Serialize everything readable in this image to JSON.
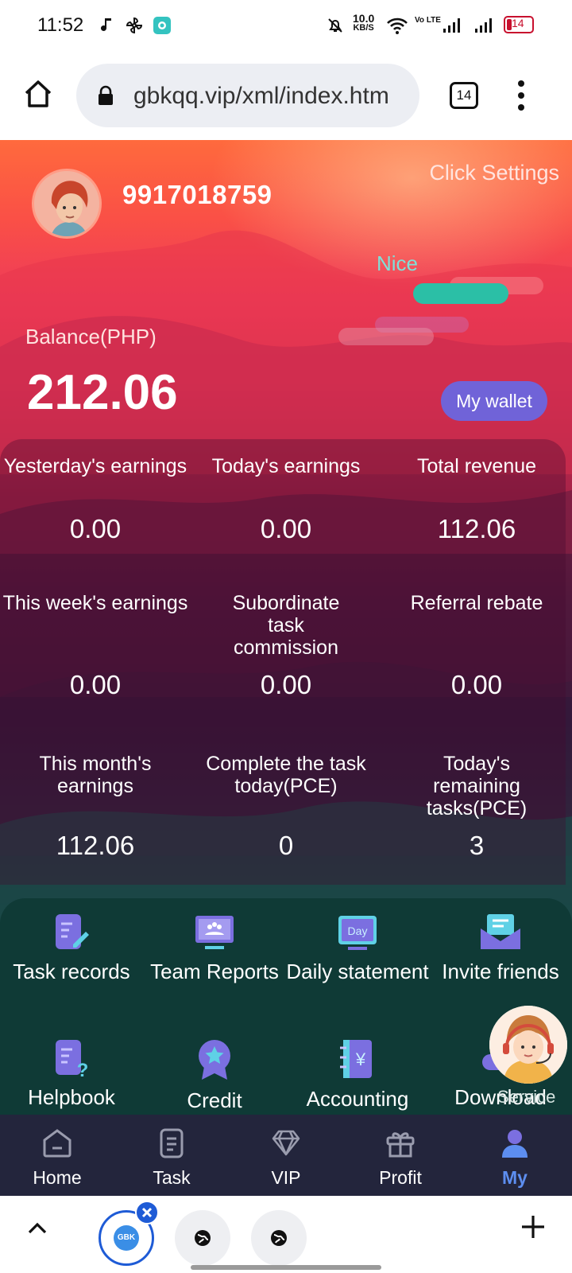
{
  "status_bar": {
    "time": "11:52",
    "net_speed_value": "10.0",
    "net_speed_unit": "KB/S",
    "volte": "Vo LTE",
    "battery": "14"
  },
  "browser": {
    "url": "gbkqq.vip/xml/index.htm",
    "tab_count": "14"
  },
  "profile": {
    "username": "9917018759",
    "settings_link": "Click Settings",
    "nice_label": "Nice"
  },
  "balance": {
    "label": "Balance(PHP)",
    "value": "212.06",
    "wallet_button": "My wallet"
  },
  "stats": [
    {
      "label": "Yesterday's earnings",
      "value": "0.00"
    },
    {
      "label": "Today's earnings",
      "value": "0.00"
    },
    {
      "label": "Total revenue",
      "value": "112.06"
    },
    {
      "label": "This week's earnings",
      "value": "0.00"
    },
    {
      "label": "Subordinate task commission",
      "value": "0.00"
    },
    {
      "label": "Referral rebate",
      "value": "0.00"
    },
    {
      "label": "This month's earnings",
      "value": "112.06"
    },
    {
      "label": "Complete the task today(PCE)",
      "value": "0"
    },
    {
      "label": "Today's remaining tasks(PCE)",
      "value": "3"
    }
  ],
  "menu": [
    {
      "label": "Task records",
      "icon": "document-edit-icon"
    },
    {
      "label": "Team Reports",
      "icon": "team-monitor-icon"
    },
    {
      "label": "Daily statement",
      "icon": "day-calendar-icon"
    },
    {
      "label": "Invite friends",
      "icon": "envelope-icon"
    },
    {
      "label": "Helpbook",
      "icon": "help-book-icon"
    },
    {
      "label": "Credit",
      "icon": "medal-icon"
    },
    {
      "label": "Accounting",
      "icon": "ledger-icon"
    },
    {
      "label": "Download",
      "icon": "cloud-download-icon"
    }
  ],
  "service_label": "Service",
  "bottom_nav": [
    {
      "label": "Home",
      "icon": "home-icon",
      "active": false
    },
    {
      "label": "Task",
      "icon": "task-icon",
      "active": false
    },
    {
      "label": "VIP",
      "icon": "diamond-icon",
      "active": false
    },
    {
      "label": "Profit",
      "icon": "gift-icon",
      "active": false
    },
    {
      "label": "My",
      "icon": "user-icon",
      "active": true
    }
  ],
  "colors": {
    "accent": "#7063d8",
    "nav_active": "#5d8ef0",
    "menu_icon": "#7b6fe0"
  }
}
